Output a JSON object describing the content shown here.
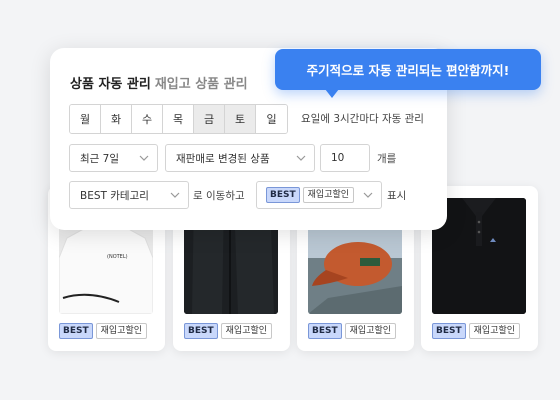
{
  "panel": {
    "title": "상품 자동 관리",
    "subtitle": "재입고 상품 관리",
    "days": [
      {
        "label": "월",
        "active": false
      },
      {
        "label": "화",
        "active": false
      },
      {
        "label": "수",
        "active": false
      },
      {
        "label": "목",
        "active": false
      },
      {
        "label": "금",
        "active": true
      },
      {
        "label": "토",
        "active": true
      },
      {
        "label": "일",
        "active": false
      }
    ],
    "schedule_note": "요일에 3시간마다 자동 관리",
    "period_select": "최근 7일",
    "condition_select": "재판매로 변경된 상품",
    "count_value": "10",
    "count_unit": "개를",
    "category_select": "BEST 카테고리",
    "move_text": "로 이동하고",
    "tag_select_best": "BEST",
    "tag_select_restock": "재입고할인",
    "display_text": "표시"
  },
  "bubble": {
    "text": "주기적으로 자동 관리되는 편안함까지!"
  },
  "products": [
    {
      "tag_best": "BEST",
      "tag_restock": "재입고할인",
      "image": "white-tshirt",
      "print": "(NOTEL)"
    },
    {
      "tag_best": "BEST",
      "tag_restock": "재입고할인",
      "image": "black-jeans"
    },
    {
      "tag_best": "BEST",
      "tag_restock": "재입고할인",
      "image": "orange-cap"
    },
    {
      "tag_best": "BEST",
      "tag_restock": "재입고할인",
      "image": "black-polo"
    }
  ],
  "colors": {
    "accent": "#3a81f0",
    "best_tag_bg": "#c9d8fb",
    "best_tag_border": "#7a97d8"
  }
}
